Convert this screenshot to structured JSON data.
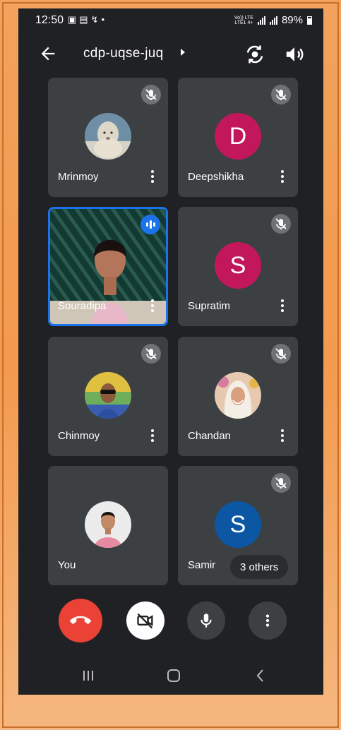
{
  "status_bar": {
    "time": "12:50",
    "left_icons": [
      "image-icon",
      "message-icon",
      "missed-call-icon",
      "dot-icon"
    ],
    "network": "VoLTE LTE+",
    "battery": "89%"
  },
  "header": {
    "meeting_code": "cdp-uqse-juq",
    "back_icon": "arrow-back-icon",
    "switch_camera_icon": "switch-camera-icon",
    "speaker_icon": "speaker-icon"
  },
  "participants": [
    {
      "name": "Mrinmoy",
      "avatar": "photo-lion",
      "muted": true
    },
    {
      "name": "Deepshikha",
      "avatar_letter": "D",
      "avatar_color": "#c2185b",
      "muted": true
    },
    {
      "name": "Souradipa",
      "video": true,
      "speaking": true
    },
    {
      "name": "Supratim",
      "avatar_letter": "S",
      "avatar_color": "#c2185b",
      "muted": true
    },
    {
      "name": "Chinmoy",
      "avatar": "photo-man-sunglasses",
      "muted": true
    },
    {
      "name": "Chandan",
      "avatar": "photo-woman-scarf",
      "muted": true
    },
    {
      "name": "You",
      "avatar": "photo-man-pink-shirt",
      "muted": false
    },
    {
      "name": "Samir",
      "avatar_letter": "S",
      "avatar_color": "#0b57a4",
      "muted": true,
      "others_label": "3 others"
    }
  ],
  "controls": {
    "end_call_color": "#ea4335",
    "items": [
      "end-call-icon",
      "camera-off-icon",
      "microphone-icon",
      "more-options-icon"
    ]
  },
  "nav": [
    "recent-apps-icon",
    "home-icon",
    "back-icon"
  ]
}
